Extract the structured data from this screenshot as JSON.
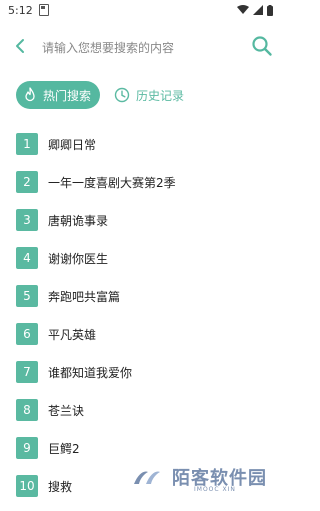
{
  "status_bar": {
    "time": "5:12"
  },
  "search": {
    "placeholder": "请输入您想要搜索的内容"
  },
  "tabs": [
    {
      "label": "热门搜索",
      "active": true
    },
    {
      "label": "历史记录",
      "active": false
    }
  ],
  "hot_list": [
    {
      "rank": "1",
      "title": "卿卿日常"
    },
    {
      "rank": "2",
      "title": "一年一度喜剧大赛第2季"
    },
    {
      "rank": "3",
      "title": "唐朝诡事录"
    },
    {
      "rank": "4",
      "title": "谢谢你医生"
    },
    {
      "rank": "5",
      "title": "奔跑吧共富篇"
    },
    {
      "rank": "6",
      "title": "平凡英雄"
    },
    {
      "rank": "7",
      "title": "谁都知道我爱你"
    },
    {
      "rank": "8",
      "title": "苍兰诀"
    },
    {
      "rank": "9",
      "title": "巨鳄2"
    },
    {
      "rank": "10",
      "title": "搜救"
    }
  ],
  "watermark": {
    "text": "陌客软件园",
    "sub": "IMOOC XIN"
  },
  "colors": {
    "accent": "#55b8a0",
    "badge": "#5ab9a1",
    "watermark": "#7a8fb0"
  },
  "icons": [
    "back-arrow-icon",
    "search-icon",
    "flame-icon",
    "clock-icon",
    "wifi-icon",
    "signal-icon",
    "battery-icon",
    "sim-icon"
  ]
}
